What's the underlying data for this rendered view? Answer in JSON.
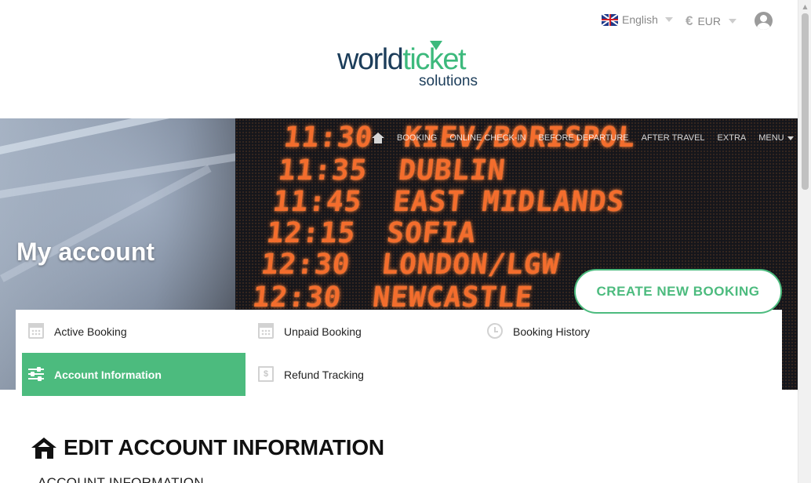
{
  "header": {
    "language": "English",
    "currency_symbol": "€",
    "currency": "EUR",
    "logo": {
      "main_a": "world",
      "main_b": "ticket",
      "sub": "solutions"
    }
  },
  "nav": {
    "items": [
      "BOOKING",
      "ONLINE CHECK-IN",
      "BEFORE DEPARTURE",
      "AFTER TRAVEL",
      "EXTRA",
      "MENU"
    ]
  },
  "hero": {
    "title": "My account",
    "board": [
      {
        "time": "11:30",
        "destination": "KIEV/BORISPOL"
      },
      {
        "time": "11:35",
        "destination": "DUBLIN"
      },
      {
        "time": "11:45",
        "destination": "EAST MIDLANDS"
      },
      {
        "time": "12:15",
        "destination": "SOFIA"
      },
      {
        "time": "12:30",
        "destination": "LONDON/LGW"
      },
      {
        "time": "12:30",
        "destination": "NEWCASTLE"
      }
    ]
  },
  "create_button": "CREATE NEW BOOKING",
  "account_menu": {
    "active_booking": "Active Booking",
    "unpaid_booking": "Unpaid Booking",
    "booking_history": "Booking History",
    "account_information": "Account Information",
    "refund_tracking": "Refund Tracking",
    "receipt_symbol": "$"
  },
  "content": {
    "title": "EDIT ACCOUNT INFORMATION",
    "subheading": "ACCOUNT INFORMATION"
  },
  "colors": {
    "accent": "#4cbb7e",
    "brand_dark": "#1c3d5a",
    "board_led": "#f36d2d"
  },
  "icons": [
    "uk-flag-icon",
    "euro-icon",
    "user-icon",
    "home-icon",
    "calendar-icon",
    "clock-icon",
    "sliders-icon",
    "receipt-icon"
  ]
}
